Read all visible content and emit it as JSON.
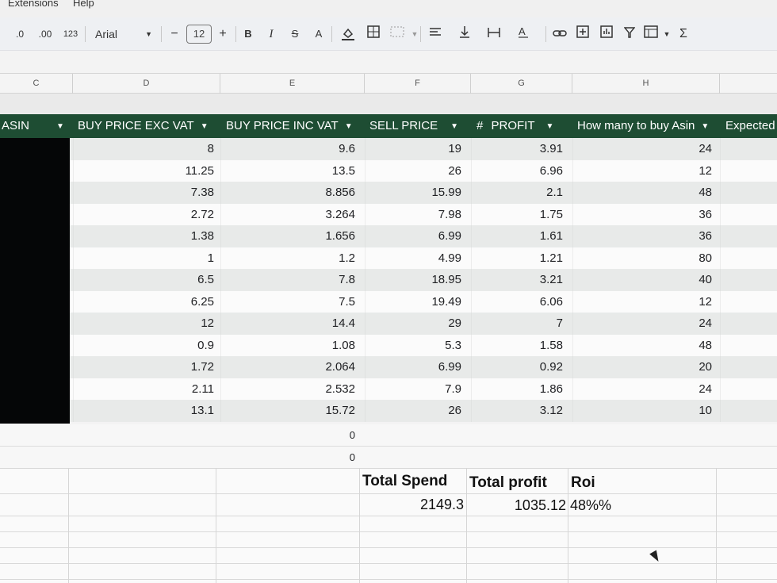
{
  "menu": {
    "extensions": "Extensions",
    "help": "Help"
  },
  "toolbar": {
    "decrease_decimal": ".0",
    "increase_decimal": ".00",
    "more_formats": "123",
    "font": "Arial",
    "font_size": "12",
    "minus": "−",
    "plus": "+",
    "bold": "B",
    "italic": "I",
    "strike": "S",
    "text_color": "A",
    "sum": "Σ"
  },
  "columns": [
    "C",
    "D",
    "E",
    "F",
    "G",
    "H"
  ],
  "headers": {
    "asin": "ASIN",
    "buy_exc": "BUY PRICE EXC VAT",
    "buy_inc": "BUY PRICE INC VAT",
    "sell": "SELL PRICE",
    "profit_prefix": "#",
    "profit": "PROFIT",
    "how_many": "How many to buy Asin",
    "expected": "Expected"
  },
  "rows": [
    {
      "exc": "8",
      "inc": "9.6",
      "sell": "19",
      "profit": "3.91",
      "qty": "24"
    },
    {
      "exc": "11.25",
      "inc": "13.5",
      "sell": "26",
      "profit": "6.96",
      "qty": "12"
    },
    {
      "exc": "7.38",
      "inc": "8.856",
      "sell": "15.99",
      "profit": "2.1",
      "qty": "48"
    },
    {
      "exc": "2.72",
      "inc": "3.264",
      "sell": "7.98",
      "profit": "1.75",
      "qty": "36"
    },
    {
      "exc": "1.38",
      "inc": "1.656",
      "sell": "6.99",
      "profit": "1.61",
      "qty": "36"
    },
    {
      "exc": "1",
      "inc": "1.2",
      "sell": "4.99",
      "profit": "1.21",
      "qty": "80"
    },
    {
      "exc": "6.5",
      "inc": "7.8",
      "sell": "18.95",
      "profit": "3.21",
      "qty": "40"
    },
    {
      "exc": "6.25",
      "inc": "7.5",
      "sell": "19.49",
      "profit": "6.06",
      "qty": "12"
    },
    {
      "exc": "12",
      "inc": "14.4",
      "sell": "29",
      "profit": "7",
      "qty": "24"
    },
    {
      "exc": "0.9",
      "inc": "1.08",
      "sell": "5.3",
      "profit": "1.58",
      "qty": "48"
    },
    {
      "exc": "1.72",
      "inc": "2.064",
      "sell": "6.99",
      "profit": "0.92",
      "qty": "20"
    },
    {
      "exc": "2.11",
      "inc": "2.532",
      "sell": "7.9",
      "profit": "1.86",
      "qty": "24"
    },
    {
      "exc": "13.1",
      "inc": "15.72",
      "sell": "26",
      "profit": "3.12",
      "qty": "10"
    }
  ],
  "empty_rows": [
    "0",
    "0"
  ],
  "summary": {
    "total_spend_label": "Total Spend",
    "total_spend_value": "2149.3",
    "total_profit_label": "Total profit",
    "total_profit_value": "1035.12",
    "roi_label": "Roi",
    "roi_value": "48%%"
  },
  "colors": {
    "header_bg": "#1e4d33",
    "band_alt": "#e8eae9"
  }
}
